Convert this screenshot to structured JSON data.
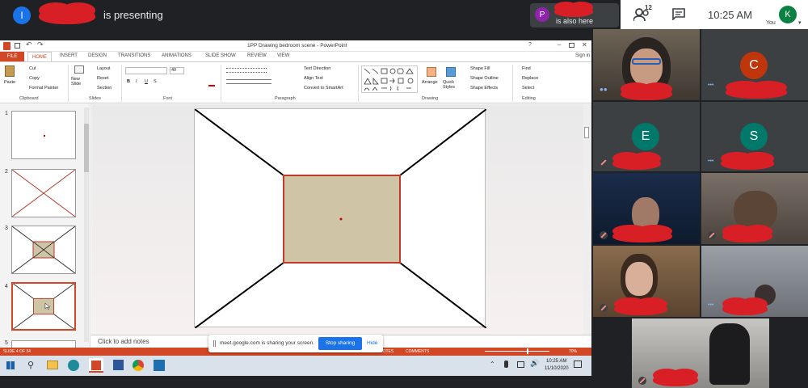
{
  "meet": {
    "presenter_initial": "I",
    "presenter_text": "is presenting",
    "also_here_initial": "P",
    "also_here_text": "is also here",
    "people_count": "12",
    "clock": "10:25 AM",
    "you_initial": "K",
    "you_label": "You",
    "colors": {
      "presenter_avatar": "#1a73e8",
      "also_avatar": "#8e24aa",
      "you_avatar": "#0b8043"
    }
  },
  "participants": [
    {
      "initial": "C",
      "color": "#bf360c"
    },
    {
      "initial": "E",
      "color": "#00796b"
    },
    {
      "initial": "S",
      "color": "#00796b"
    }
  ],
  "ppt": {
    "title": "1PP Drawing bedroom scene - PowerPoint",
    "signin": "Sign in",
    "tabs": [
      "FILE",
      "HOME",
      "INSERT",
      "DESIGN",
      "TRANSITIONS",
      "ANIMATIONS",
      "SLIDE SHOW",
      "REVIEW",
      "VIEW"
    ],
    "groups": {
      "clipboard": "Clipboard",
      "slides": "Slides",
      "font": "Font",
      "paragraph": "Paragraph",
      "drawing": "Drawing",
      "editing": "Editing"
    },
    "clipboard": {
      "paste": "Paste",
      "cut": "Cut",
      "copy": "Copy",
      "format_painter": "Format Painter"
    },
    "slides": {
      "new_slide": "New Slide",
      "layout": "Layout",
      "reset": "Reset",
      "section": "Section"
    },
    "font": {
      "size": "40"
    },
    "paragraph": {
      "text_direction": "Text Direction",
      "align_text": "Align Text",
      "smartart": "Convert to SmartArt"
    },
    "drawing": {
      "arrange": "Arrange",
      "quick_styles": "Quick Styles",
      "shape_fill": "Shape Fill",
      "shape_outline": "Shape Outline",
      "shape_effects": "Shape Effects"
    },
    "editing": {
      "find": "Find",
      "replace": "Replace",
      "select": "Select"
    },
    "thumb_numbers": [
      "1",
      "2",
      "3",
      "4",
      "5"
    ],
    "notes_placeholder": "Click to add notes",
    "status_slide": "SLIDE 4 OF 34",
    "status_notes": "NOTES",
    "status_comments": "COMMENTS",
    "zoom": "70%",
    "share_banner": {
      "text": "meet.google.com is sharing your screen.",
      "stop": "Stop sharing",
      "hide": "Hide"
    },
    "taskbar": {
      "time": "10:25 AM",
      "date": "11/10/2020"
    },
    "colors": {
      "accent": "#d24726",
      "room_fill": "#cfc4a6",
      "room_stroke": "#c0392b"
    }
  }
}
